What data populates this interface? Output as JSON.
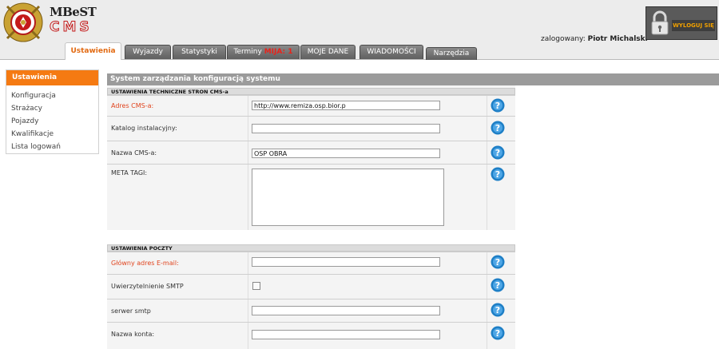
{
  "brand": {
    "line1": "MBeST",
    "line2": "CMS"
  },
  "user": {
    "prefix": "zalogowany:",
    "name": "Piotr Michalski"
  },
  "logout": {
    "label": "WYLOGUJ SIĘ"
  },
  "tabs": [
    {
      "label": "Ustawienia",
      "active": true
    },
    {
      "label": "Wyjazdy"
    },
    {
      "label": "Statystyki"
    },
    {
      "label": "Terminy",
      "warn": "MIJA: 1"
    },
    {
      "label": "MOJE DANE"
    },
    {
      "label": "WIADOMOŚCI"
    },
    {
      "label": "Narzędzia"
    }
  ],
  "sidebar": {
    "header": "Ustawienia",
    "items": [
      {
        "label": "Konfiguracja"
      },
      {
        "label": "Strażacy"
      },
      {
        "label": "Pojazdy"
      },
      {
        "label": "Kwalifikacje"
      },
      {
        "label": "Lista logowań"
      }
    ]
  },
  "panel": {
    "title": "System zarządzania konfiguracją systemu",
    "section1": "USTAWIENIA TECHNICZNE STRON CMS-a",
    "section2": "USTAWIENIA POCZTY",
    "fields": {
      "adres_cms": {
        "label": "Adres CMS-a:",
        "value": "http://www.remiza.osp.bior.p"
      },
      "katalog": {
        "label": "Katalog instalacyjny:",
        "value": ""
      },
      "nazwa_cms": {
        "label": "Nazwa CMS-a:",
        "value": "OSP OBRA"
      },
      "meta": {
        "label": "META TAGI:",
        "value": ""
      },
      "email": {
        "label": "Główny adres E-mail:",
        "value": ""
      },
      "smtp_auth": {
        "label": "Uwierzytelnienie SMTP",
        "checked": false
      },
      "smtp_server": {
        "label": "serwer smtp",
        "value": ""
      },
      "account": {
        "label": "Nazwa konta:",
        "value": ""
      }
    }
  },
  "colors": {
    "accent": "#f57a12",
    "tab_bg": "#6e6e6e",
    "required": "#e0441e",
    "help_icon": "#1e7fc6"
  },
  "icons": {
    "help": "help-question-icon",
    "logout": "padlock-icon",
    "emblem": "fire-brigade-emblem-icon"
  }
}
